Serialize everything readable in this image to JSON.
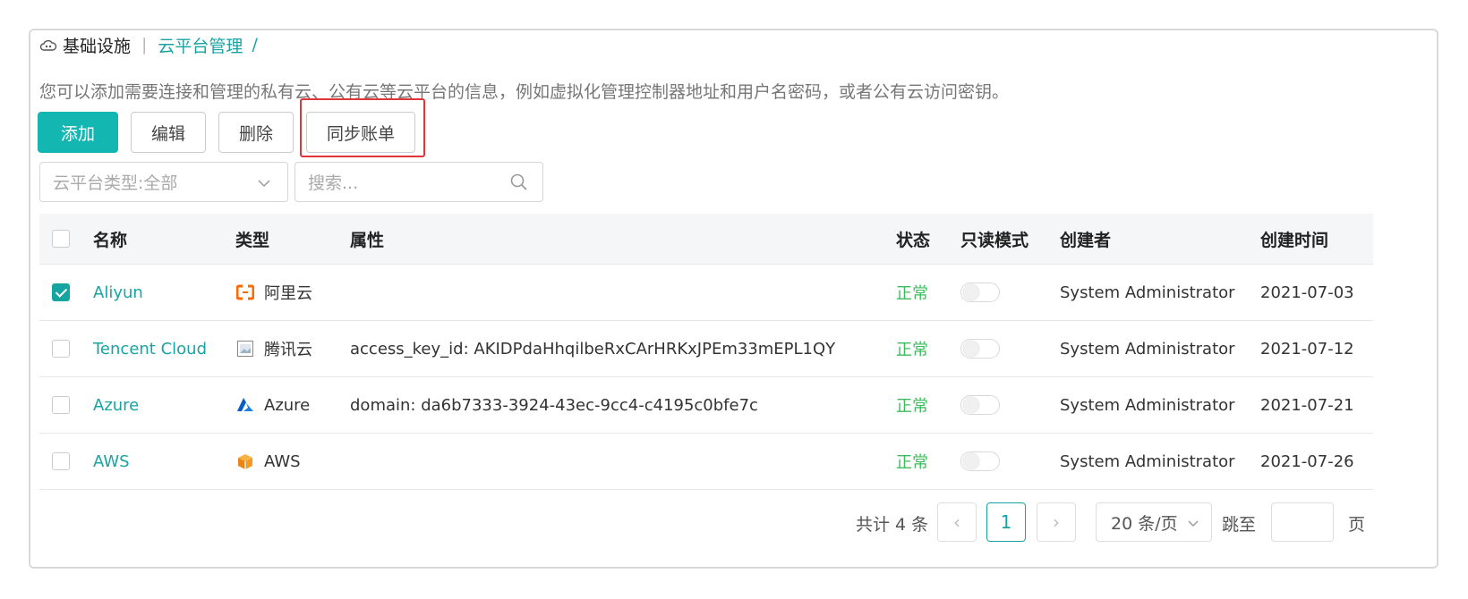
{
  "breadcrumb": {
    "root": "基础设施",
    "current": "云平台管理",
    "slash": "/"
  },
  "description": "您可以添加需要连接和管理的私有云、公有云等云平台的信息，例如虚拟化管理控制器地址和用户名密码，或者公有云访问密钥。",
  "toolbar": {
    "add": "添加",
    "edit": "编辑",
    "delete": "删除",
    "sync_bill": "同步账单"
  },
  "filters": {
    "type_select": "云平台类型:全部",
    "search_placeholder": "搜索..."
  },
  "table": {
    "columns": {
      "name": "名称",
      "type": "类型",
      "attributes": "属性",
      "status": "状态",
      "readonly": "只读模式",
      "creator": "创建者",
      "created": "创建时间"
    },
    "rows": [
      {
        "checked": true,
        "name": "Aliyun",
        "type": "阿里云",
        "type_icon": "aliyun-icon",
        "attributes": "",
        "status": "正常",
        "readonly": false,
        "creator": "System Administrator",
        "created": "2021-07-03"
      },
      {
        "checked": false,
        "name": "Tencent Cloud",
        "type": "腾讯云",
        "type_icon": "tencent-icon",
        "attributes": "access_key_id: AKIDPdaHhqilbeRxCArHRKxJPEm33mEPL1QY",
        "status": "正常",
        "readonly": false,
        "creator": "System Administrator",
        "created": "2021-07-12"
      },
      {
        "checked": false,
        "name": "Azure",
        "type": "Azure",
        "type_icon": "azure-icon",
        "attributes": "domain: da6b7333-3924-43ec-9cc4-c4195c0bfe7c",
        "status": "正常",
        "readonly": false,
        "creator": "System Administrator",
        "created": "2021-07-21"
      },
      {
        "checked": false,
        "name": "AWS",
        "type": "AWS",
        "type_icon": "aws-icon",
        "attributes": "",
        "status": "正常",
        "readonly": false,
        "creator": "System Administrator",
        "created": "2021-07-26"
      }
    ]
  },
  "pagination": {
    "total": "共计 4 条",
    "prev": "‹",
    "current_page": "1",
    "next": "›",
    "page_size": "20 条/页",
    "jump_label": "跳至",
    "page_suffix": "页"
  },
  "colors": {
    "accent": "#14b6b2",
    "link": "#1aa3a3",
    "status_ok": "#3cbc5c",
    "highlight": "#e0363a"
  }
}
